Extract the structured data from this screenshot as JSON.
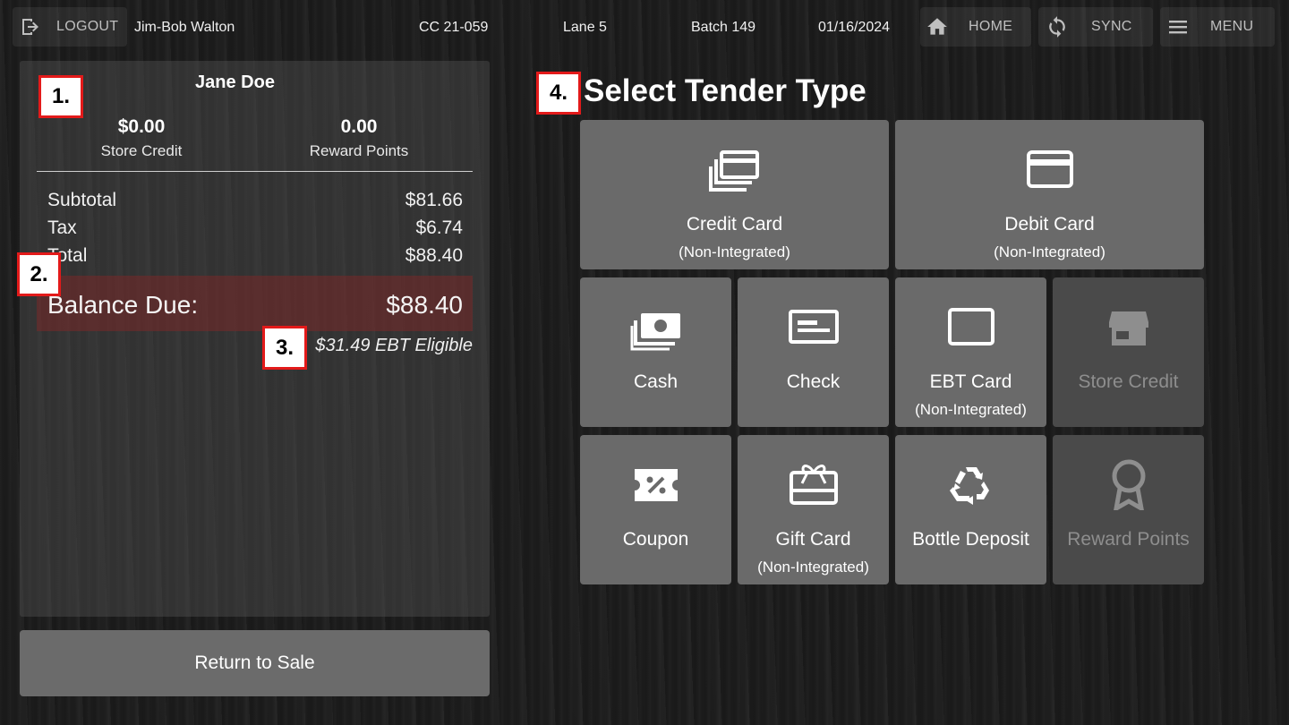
{
  "topbar": {
    "logout_label": "LOGOUT",
    "user_name": "Jim-Bob Walton",
    "register_id": "CC 21-059",
    "lane": "Lane 5",
    "batch": "Batch 149",
    "date": "01/16/2024",
    "home_label": "HOME",
    "sync_label": "SYNC",
    "menu_label": "MENU"
  },
  "customer": {
    "name": "Jane Doe",
    "store_credit_value": "$0.00",
    "store_credit_label": "Store Credit",
    "reward_points_value": "0.00",
    "reward_points_label": "Reward Points"
  },
  "summary": {
    "subtotal_label": "Subtotal",
    "subtotal_value": "$81.66",
    "tax_label": "Tax",
    "tax_value": "$6.74",
    "total_label": "Total",
    "total_value": "$88.40",
    "balance_label": "Balance Due:",
    "balance_value": "$88.40",
    "ebt_eligible": "$31.49 EBT Eligible"
  },
  "markers": [
    "1.",
    "2.",
    "3.",
    "4."
  ],
  "return_button_label": "Return to Sale",
  "tender": {
    "title": "Select Tender Type",
    "tiles": [
      {
        "label": "Credit Card",
        "sub": "(Non-Integrated)",
        "icon": "credit-card-stack-icon",
        "enabled": true
      },
      {
        "label": "Debit Card",
        "sub": "(Non-Integrated)",
        "icon": "debit-card-icon",
        "enabled": true
      },
      {
        "label": "Cash",
        "sub": "",
        "icon": "cash-icon",
        "enabled": true
      },
      {
        "label": "Check",
        "sub": "",
        "icon": "check-icon",
        "enabled": true
      },
      {
        "label": "EBT Card",
        "sub": "(Non-Integrated)",
        "icon": "ebt-card-icon",
        "enabled": true
      },
      {
        "label": "Store Credit",
        "sub": "",
        "icon": "storefront-icon",
        "enabled": false
      },
      {
        "label": "Coupon",
        "sub": "",
        "icon": "coupon-icon",
        "enabled": true
      },
      {
        "label": "Gift Card",
        "sub": "(Non-Integrated)",
        "icon": "gift-card-icon",
        "enabled": true
      },
      {
        "label": "Bottle Deposit",
        "sub": "",
        "icon": "recycle-icon",
        "enabled": true
      },
      {
        "label": "Reward Points",
        "sub": "",
        "icon": "award-ribbon-icon",
        "enabled": false
      }
    ]
  },
  "colors": {
    "tile_bg": "#6a6a6a",
    "tile_disabled_bg": "#4a4a4a",
    "balance_bg": "#782828",
    "marker_border": "#e31a1a"
  }
}
